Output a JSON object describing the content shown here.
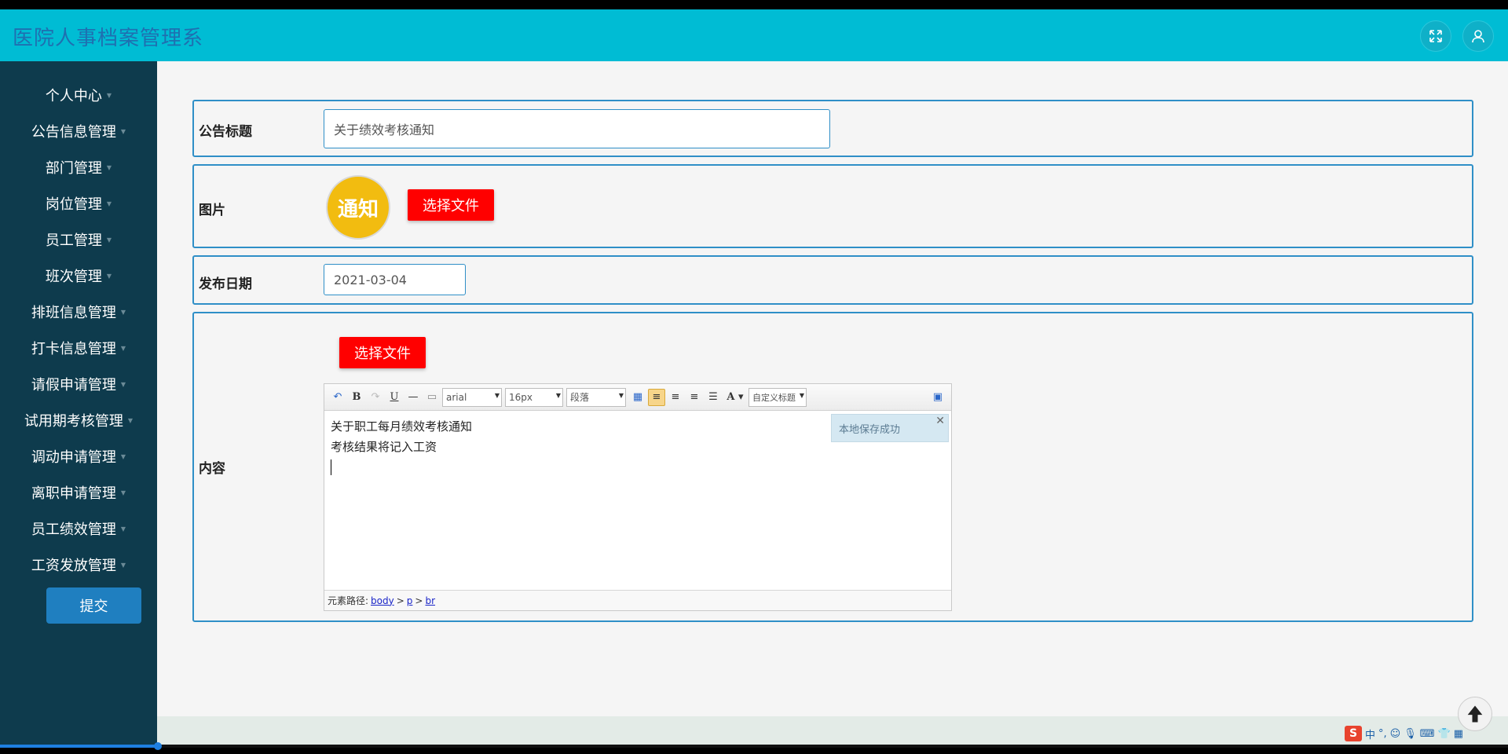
{
  "app": {
    "title": "医院人事档案管理系"
  },
  "sidebar": {
    "items": [
      {
        "label": "个人中心"
      },
      {
        "label": "公告信息管理"
      },
      {
        "label": "部门管理"
      },
      {
        "label": "岗位管理"
      },
      {
        "label": "员工管理"
      },
      {
        "label": "班次管理"
      },
      {
        "label": "排班信息管理"
      },
      {
        "label": "打卡信息管理"
      },
      {
        "label": "请假申请管理"
      },
      {
        "label": "试用期考核管理"
      },
      {
        "label": "调动申请管理"
      },
      {
        "label": "离职申请管理"
      },
      {
        "label": "员工绩效管理"
      },
      {
        "label": "工资发放管理"
      }
    ]
  },
  "form": {
    "title_label": "公告标题",
    "title_value": "关于绩效考核通知",
    "image_label": "图片",
    "image_text": "通知",
    "file_button": "选择文件",
    "date_label": "发布日期",
    "date_value": "2021-03-04",
    "content_label": "内容",
    "content_file_button": "选择文件",
    "submit_label": "提交"
  },
  "editor": {
    "font_family": "arial",
    "font_size": "16px",
    "paragraph": "段落",
    "custom_title": "自定义标题",
    "lines": [
      "关于职工每月绩效考核通知",
      "考核结果将记入工资"
    ],
    "toast": "本地保存成功",
    "path_label": "元素路径:",
    "path": [
      "body",
      "p",
      "br"
    ]
  },
  "tray": {
    "ime": "中"
  },
  "colors": {
    "topbar": "#00bcd4",
    "sidebar": "#0e3b4d",
    "accent": "#2f8fc7",
    "file_button": "#ff0000",
    "submit": "#1f7fc0"
  }
}
